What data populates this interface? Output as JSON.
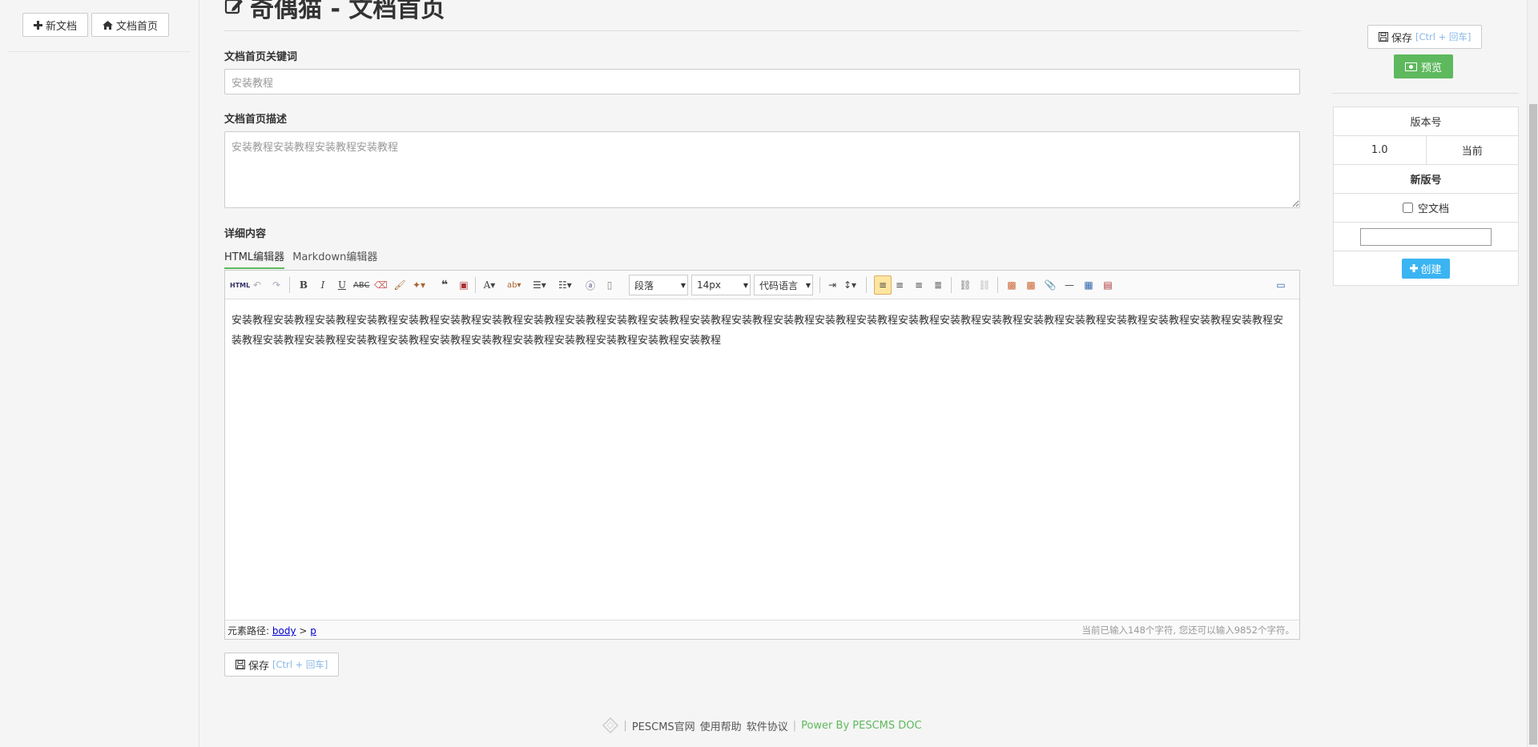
{
  "left": {
    "new_doc": "新文档",
    "doc_home": "文档首页"
  },
  "main": {
    "title": "奇偶猫 - 文档首页",
    "keywords_label": "文档首页关键词",
    "keywords_value": "安装教程",
    "desc_label": "文档首页描述",
    "desc_value": "安装教程安装教程安装教程安装教程",
    "content_label": "详细内容",
    "tabs": [
      {
        "label": "HTML编辑器"
      },
      {
        "label": "Markdown编辑器"
      }
    ],
    "editor": {
      "paragraph": "段落",
      "font_size": "14px",
      "code_lang": "代码语言",
      "body_text": "安装教程安装教程安装教程安装教程安装教程安装教程安装教程安装教程安装教程安装教程安装教程安装教程安装教程安装教程安装教程安装教程安装教程安装教程安装教程安装教程安装教程安装教程安装教程安装教程安装教程安装教程安装教程安装教程安装教程安装教程安装教程安装教程安装教程安装教程安装教程安装教程安装教程",
      "path_label": "元素路径:",
      "path_body": "body",
      "path_sep": ">",
      "path_p": "p",
      "word_count": "当前已输入148个字符, 您还可以输入9852个字符。"
    },
    "save_label": "保存",
    "save_hint": "[Ctrl + 回车]"
  },
  "footer": {
    "links": [
      "PESCMS官网",
      "使用帮助",
      "软件协议"
    ],
    "power": "Power By PESCMS DOC"
  },
  "right": {
    "save_label": "保存",
    "save_hint": "[Ctrl + 回车]",
    "preview_label": "预览",
    "version_header": "版本号",
    "version_value": "1.0",
    "version_current": "当前",
    "new_version": "新版号",
    "empty_doc": "空文档",
    "create_label": "创建"
  }
}
